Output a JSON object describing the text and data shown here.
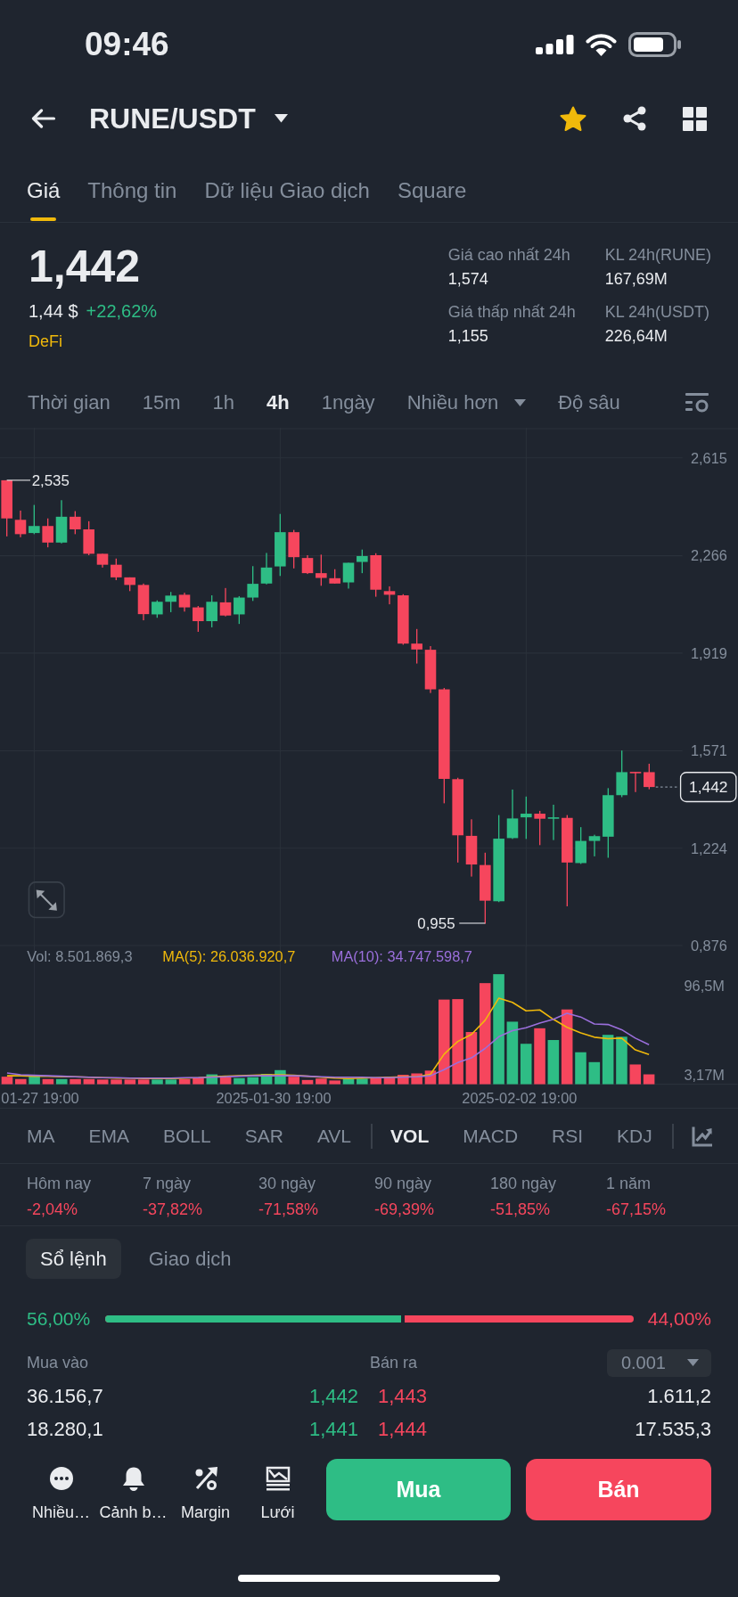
{
  "status_bar": {
    "time": "09:46"
  },
  "header": {
    "title": "RUNE/USDT",
    "favorite": true
  },
  "tabs": [
    {
      "label": "Giá",
      "selected": true
    },
    {
      "label": "Thông tin",
      "selected": false
    },
    {
      "label": "Dữ liệu Giao dịch",
      "selected": false
    },
    {
      "label": "Square",
      "selected": false
    }
  ],
  "price": {
    "last": "1,442",
    "usd": "1,44 $",
    "change": "+22,62%",
    "tag": "DeFi"
  },
  "stats": [
    {
      "label": "Giá cao nhất 24h",
      "value": "1,574"
    },
    {
      "label": "KL 24h(RUNE)",
      "value": "167,69M"
    },
    {
      "label": "Giá thấp nhất 24h",
      "value": "1,155"
    },
    {
      "label": "KL 24h(USDT)",
      "value": "226,64M"
    }
  ],
  "intervals": [
    {
      "label": "Thời gian",
      "kind": "tab",
      "selected": false
    },
    {
      "label": "15m",
      "kind": "tab",
      "selected": false
    },
    {
      "label": "1h",
      "kind": "tab",
      "selected": false
    },
    {
      "label": "4h",
      "kind": "tab",
      "selected": true
    },
    {
      "label": "1ngày",
      "kind": "tab",
      "selected": false
    },
    {
      "label": "Nhiều hơn",
      "kind": "dropdown",
      "selected": false
    },
    {
      "label": "Độ sâu",
      "kind": "tab",
      "selected": false
    }
  ],
  "chart": {
    "chart_data": {
      "type": "candlestick",
      "categories": [
        null,
        null,
        null,
        null,
        null,
        null,
        null,
        null,
        null,
        null,
        null,
        null,
        null,
        null,
        null,
        null,
        null,
        null,
        null,
        null,
        null,
        null,
        null,
        null,
        null,
        null,
        null,
        null,
        null,
        null,
        null,
        null,
        null,
        null,
        null,
        null,
        null,
        null,
        null,
        null,
        null,
        null,
        null,
        null,
        null,
        null,
        null,
        null,
        null,
        null,
        null,
        null,
        null,
        null
      ],
      "ohlc": [
        [
          2.535,
          2.535,
          2.335,
          2.399
        ],
        [
          2.394,
          2.427,
          2.332,
          2.343
        ],
        [
          2.347,
          2.447,
          2.343,
          2.372
        ],
        [
          2.372,
          2.399,
          2.296,
          2.313
        ],
        [
          2.313,
          2.464,
          2.31,
          2.405
        ],
        [
          2.405,
          2.425,
          2.343,
          2.36
        ],
        [
          2.36,
          2.389,
          2.268,
          2.273
        ],
        [
          2.273,
          2.273,
          2.224,
          2.234
        ],
        [
          2.234,
          2.256,
          2.179,
          2.189
        ],
        [
          2.189,
          2.189,
          2.14,
          2.162
        ],
        [
          2.162,
          2.167,
          2.036,
          2.058
        ],
        [
          2.057,
          2.107,
          2.045,
          2.102
        ],
        [
          2.102,
          2.137,
          2.065,
          2.124
        ],
        [
          2.127,
          2.134,
          2.067,
          2.082
        ],
        [
          2.082,
          2.087,
          1.995,
          2.033
        ],
        [
          2.033,
          2.125,
          2.011,
          2.102
        ],
        [
          2.1,
          2.151,
          2.05,
          2.053
        ],
        [
          2.057,
          2.122,
          2.023,
          2.117
        ],
        [
          2.117,
          2.229,
          2.105,
          2.166
        ],
        [
          2.167,
          2.276,
          2.164,
          2.224
        ],
        [
          2.228,
          2.415,
          2.194,
          2.35
        ],
        [
          2.35,
          2.358,
          2.221,
          2.261
        ],
        [
          2.258,
          2.268,
          2.201,
          2.204
        ],
        [
          2.204,
          2.27,
          2.159,
          2.187
        ],
        [
          2.186,
          2.218,
          2.167,
          2.167
        ],
        [
          2.171,
          2.241,
          2.149,
          2.241
        ],
        [
          2.244,
          2.288,
          2.204,
          2.265
        ],
        [
          2.268,
          2.275,
          2.12,
          2.145
        ],
        [
          2.14,
          2.157,
          2.093,
          2.127
        ],
        [
          2.125,
          2.129,
          1.949,
          1.953
        ],
        [
          1.953,
          2.005,
          1.882,
          1.932
        ],
        [
          1.931,
          1.944,
          1.777,
          1.79
        ],
        [
          1.79,
          1.795,
          1.384,
          1.471
        ],
        [
          1.47,
          1.475,
          1.173,
          1.27
        ],
        [
          1.268,
          1.327,
          1.123,
          1.166
        ],
        [
          1.164,
          1.208,
          0.955,
          1.037
        ],
        [
          1.035,
          1.342,
          1.032,
          1.258
        ],
        [
          1.26,
          1.433,
          1.257,
          1.33
        ],
        [
          1.334,
          1.408,
          1.257,
          1.347
        ],
        [
          1.347,
          1.357,
          1.235,
          1.329
        ],
        [
          1.329,
          1.379,
          1.253,
          1.334
        ],
        [
          1.332,
          1.342,
          1.017,
          1.173
        ],
        [
          1.171,
          1.299,
          1.168,
          1.25
        ],
        [
          1.25,
          1.272,
          1.195,
          1.267
        ],
        [
          1.265,
          1.438,
          1.19,
          1.413
        ],
        [
          1.413,
          1.572,
          1.406,
          1.495
        ],
        [
          1.496,
          1.496,
          1.424,
          1.491
        ],
        [
          1.495,
          1.525,
          1.434,
          1.442
        ],
        null,
        null,
        null,
        null,
        null,
        null
      ],
      "ylim": [
        0.874,
        2.722
      ],
      "yticks": [
        {
          "value": 2.615,
          "label": "2,615"
        },
        {
          "value": 2.266,
          "label": "2,266"
        },
        {
          "value": 1.919,
          "label": "1,919"
        },
        {
          "value": 1.571,
          "label": "1,571"
        },
        {
          "value": 1.224,
          "label": "1,224"
        },
        {
          "value": 0.876,
          "label": "0,876"
        }
      ],
      "grid": true
    },
    "high_label": "2,535",
    "low_label": "0,955",
    "last_price": "1,442"
  },
  "volume": {
    "volume_label": "Vol: 8.501.869,3",
    "moving_averages": [
      {
        "label": "MA(5): 26.036.920,7",
        "color": "#f0b90b"
      },
      {
        "label": "MA(10): 34.747.598,7",
        "color": "#9b6fdc"
      }
    ],
    "axis": [
      "96,5M",
      "3,17M"
    ],
    "dates": [
      "01-27 19:00",
      "2025-01-30 19:00",
      "2025-02-02 19:00"
    ]
  },
  "indicators": {
    "main": [
      {
        "label": "MA",
        "selected": false
      },
      {
        "label": "EMA",
        "selected": false
      },
      {
        "label": "BOLL",
        "selected": false
      },
      {
        "label": "SAR",
        "selected": false
      },
      {
        "label": "AVL",
        "selected": false
      }
    ],
    "sub": [
      {
        "label": "VOL",
        "selected": true
      },
      {
        "label": "MACD",
        "selected": false
      },
      {
        "label": "RSI",
        "selected": false
      },
      {
        "label": "KDJ",
        "selected": false
      }
    ]
  },
  "performance": [
    {
      "label": "Hôm nay",
      "value": "-2,04%"
    },
    {
      "label": "7 ngày",
      "value": "-37,82%"
    },
    {
      "label": "30 ngày",
      "value": "-71,58%"
    },
    {
      "label": "90 ngày",
      "value": "-69,39%"
    },
    {
      "label": "180 ngày",
      "value": "-51,85%"
    },
    {
      "label": "1 năm",
      "value": "-67,15%"
    }
  ],
  "order_book": {
    "tabs": [
      {
        "label": "Sổ lệnh",
        "selected": true
      },
      {
        "label": "Giao dịch",
        "selected": false
      }
    ],
    "buy_ratio": "56,00%",
    "sell_ratio": "44,00%",
    "level": 0.56,
    "columns": [
      "Mua vào",
      "Bán ra"
    ],
    "precision": "0.001",
    "rows": [
      {
        "bid_amount": "36.156,7",
        "bid_price": "1,442",
        "ask_price": "1,443",
        "ask_amount": "1.611,2"
      },
      {
        "bid_amount": "18.280,1",
        "bid_price": "1,441",
        "ask_price": "1,444",
        "ask_amount": "17.535,3"
      }
    ]
  },
  "actions": [
    {
      "label": "Nhiều…",
      "kind": "more"
    },
    {
      "label": "Cảnh b…",
      "kind": "alert"
    },
    {
      "label": "Margin",
      "kind": "margin"
    },
    {
      "label": "Lưới",
      "kind": "grid"
    }
  ],
  "trade_buttons": {
    "buy": "Mua",
    "sell": "Bán"
  }
}
